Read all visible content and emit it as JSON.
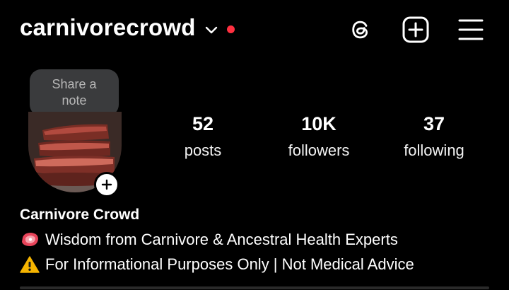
{
  "header": {
    "username": "carnivorecrowd",
    "icons": [
      "chevron-down-icon",
      "notification-dot",
      "threads-icon",
      "create-post-icon",
      "menu-icon"
    ]
  },
  "note": {
    "text_line1": "Share a",
    "text_line2": "note"
  },
  "stats": [
    {
      "value": "52",
      "label": "posts"
    },
    {
      "value": "10K",
      "label": "followers"
    },
    {
      "value": "37",
      "label": "following"
    }
  ],
  "bio": {
    "name": "Carnivore Crowd",
    "line1": "Wisdom from Carnivore & Ancestral Health Experts",
    "line2": "For Informational Purposes Only | Not Medical Advice",
    "line1_icon": "meat-emoji",
    "line2_icon": "warning-emoji"
  },
  "colors": {
    "background": "#000000",
    "notification_dot": "#ff3040",
    "note_bubble": "#3a3b3d",
    "warning": "#f5b400"
  }
}
